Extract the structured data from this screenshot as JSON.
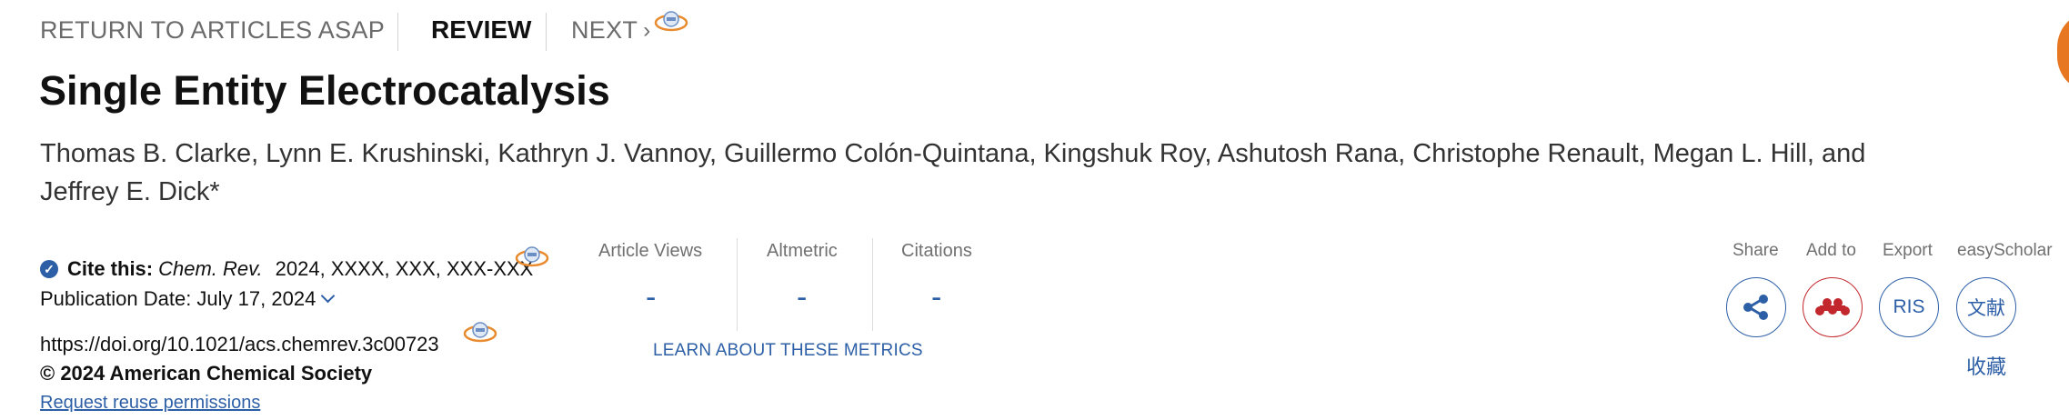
{
  "nav": {
    "return_label": "RETURN TO ARTICLES ASAP",
    "review_label": "REVIEW",
    "next_label": "NEXT"
  },
  "article": {
    "title": "Single Entity Electrocatalysis",
    "authors_line1": "Thomas B. Clarke, Lynn E. Krushinski, Kathryn J. Vannoy, Guillermo Colón-Quintana, Kingshuk Roy, Ashutosh Rana, Christophe Renault, Megan L. Hill, and",
    "authors_line2": "Jeffrey E. Dick*"
  },
  "cite": {
    "label": "Cite this:",
    "journal": "Chem. Rev.",
    "details": "2024, XXXX, XXX, XXX-XXX",
    "publication_date": "Publication Date: July 17, 2024",
    "doi": "https://doi.org/10.1021/acs.chemrev.3c00723",
    "copyright": "© 2024 American Chemical Society",
    "reuse_link": "Request reuse permissions"
  },
  "metrics": {
    "items": [
      {
        "label": "Article Views",
        "value": "-"
      },
      {
        "label": "Altmetric",
        "value": "-"
      },
      {
        "label": "Citations",
        "value": "-"
      }
    ],
    "learn_link": "LEARN ABOUT THESE METRICS"
  },
  "tools": {
    "share_label": "Share",
    "add_label": "Add to",
    "export_label": "Export",
    "easyscholar_label": "easyScholar",
    "ris_text": "RIS",
    "wenxian_text": "文献",
    "collect_text": "收藏"
  },
  "icons": {
    "check": "check-circle-icon",
    "share": "share-icon",
    "mendeley": "mendeley-icon",
    "extension": "scholar-extension-icon"
  },
  "colors": {
    "accent": "#2d5fa6",
    "mendeley_red": "#c1272d",
    "orange": "#e87722"
  }
}
